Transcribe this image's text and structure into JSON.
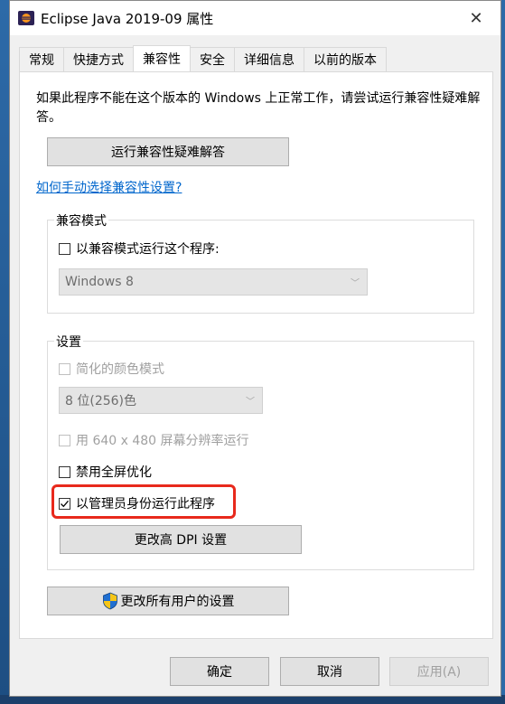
{
  "window": {
    "title": "Eclipse Java 2019-09 属性",
    "close_glyph": "✕"
  },
  "tabs": [
    {
      "label": "常规",
      "active": false
    },
    {
      "label": "快捷方式",
      "active": false
    },
    {
      "label": "兼容性",
      "active": true
    },
    {
      "label": "安全",
      "active": false
    },
    {
      "label": "详细信息",
      "active": false
    },
    {
      "label": "以前的版本",
      "active": false
    }
  ],
  "compat": {
    "intro": "如果此程序不能在这个版本的 Windows 上正常工作，请尝试运行兼容性疑难解答。",
    "troubleshooter_label": "运行兼容性疑难解答",
    "manual_link": "如何手动选择兼容性设置?",
    "mode_group_title": "兼容模式",
    "mode_checkbox_label": "以兼容模式运行这个程序:",
    "mode_checked": false,
    "os_select_value": "Windows 8"
  },
  "settings": {
    "group_title": "设置",
    "reduced_color_label": "简化的颜色模式",
    "color_select_value": "8 位(256)色",
    "res_640_label": "用 640 x 480 屏幕分辨率运行",
    "disable_fullscreen_label": "禁用全屏优化",
    "disable_fullscreen_checked": false,
    "run_as_admin_label": "以管理员身份运行此程序",
    "run_as_admin_checked": true,
    "dpi_button_label": "更改高 DPI 设置"
  },
  "all_users_button_label": "更改所有用户的设置",
  "footer": {
    "ok_label": "确定",
    "cancel_label": "取消",
    "apply_label": "应用(A)"
  },
  "colors": {
    "highlight": "#e8291c",
    "link": "#0066cc"
  }
}
